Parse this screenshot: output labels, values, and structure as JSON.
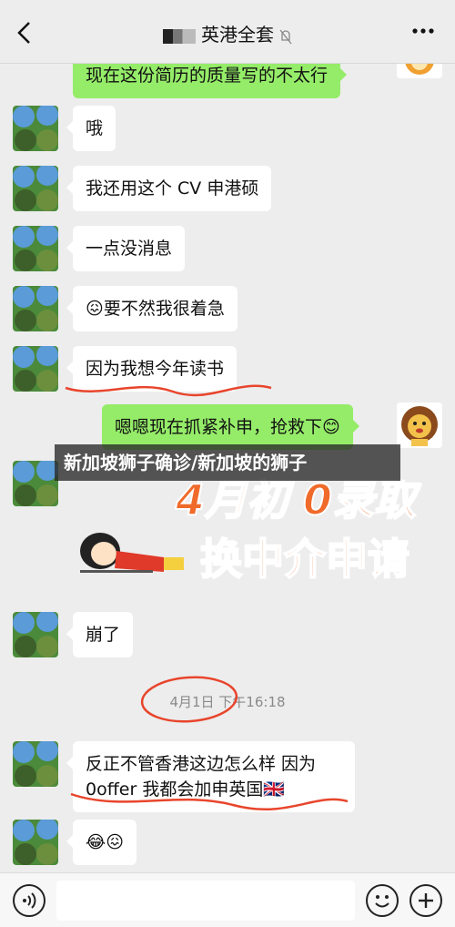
{
  "header": {
    "title": "英港全套",
    "back_icon": "chevron-left-icon",
    "mute_icon": "mute-bell-icon",
    "more_icon": "more-dots-icon"
  },
  "messages": [
    {
      "side": "right",
      "text": "现在这份简历的质量写的不太行"
    },
    {
      "side": "left",
      "text": "哦"
    },
    {
      "side": "left",
      "text": "我还用这个 CV 申港硕"
    },
    {
      "side": "left",
      "text": "一点没消息"
    },
    {
      "side": "left",
      "emoji": "😖",
      "text": "要不然我很着急"
    },
    {
      "side": "left",
      "text": "因为我想今年读书"
    },
    {
      "side": "right",
      "text": "嗯嗯现在抓紧补申，抢救下",
      "emoji": "😊"
    },
    {
      "side": "left",
      "text": "崩了"
    },
    {
      "side": "left",
      "text": "反正不管香港这边怎么样 因为0offer 我都会加申英国",
      "emoji": "🇬🇧"
    },
    {
      "side": "left",
      "emoji": "😂😖"
    }
  ],
  "sticker": {
    "line1": "4月初 0录取",
    "line2": "换中介申请"
  },
  "timestamp": "4月1日 下午16:18",
  "overlay_caption": "新加坡狮子确诊/新加坡的狮子",
  "input": {
    "voice_icon": "voice-icon",
    "emoji_icon": "emoji-icon",
    "plus_icon": "plus-icon"
  },
  "colors": {
    "bubble_right": "#95ec69",
    "bubble_left": "#ffffff",
    "background": "#ededed",
    "annotation": "#e8452c",
    "sticker_text": "#f06a2a"
  }
}
